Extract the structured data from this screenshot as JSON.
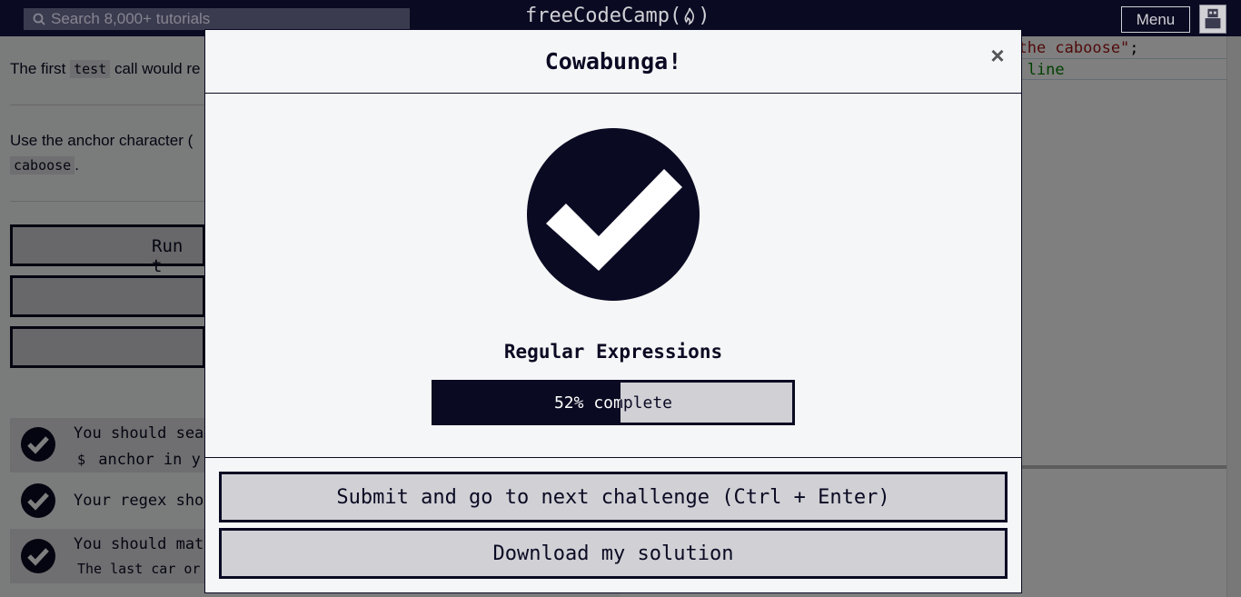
{
  "navbar": {
    "search_placeholder": "Search 8,000+ tutorials",
    "brand": [
      "freeCodeCamp",
      "(",
      ")"
    ],
    "menu_label": "Menu"
  },
  "editor": {
    "line1_string": "s the caboose\"",
    "line1_end": ";",
    "line2_comment": "is line"
  },
  "description": {
    "para1_pre": "The first ",
    "para1_code": "test",
    "para1_post": " call would re",
    "para2_pre": "Use the anchor character (",
    "para2_code": "caboose",
    "para2_post": "."
  },
  "background_buttons": {
    "run_tests": "Run t"
  },
  "tests": [
    {
      "line1": "You should sea",
      "line2_code": "$",
      "line2_rest": " anchor in y"
    },
    {
      "line1": "Your regex sho"
    },
    {
      "line1": "You should mat",
      "line2_code": "The last car or"
    }
  ],
  "modal": {
    "title": "Cowabunga!",
    "close": "×",
    "block_name": "Regular Expressions",
    "progress_percent": 52,
    "progress_label": "52% complete",
    "submit_label": "Submit and go to next challenge (Ctrl + Enter)",
    "download_label": "Download my solution"
  },
  "colors": {
    "primary": "#0a0a23",
    "surface": "#f5f6f7",
    "button_bg": "#d0d0d5"
  }
}
